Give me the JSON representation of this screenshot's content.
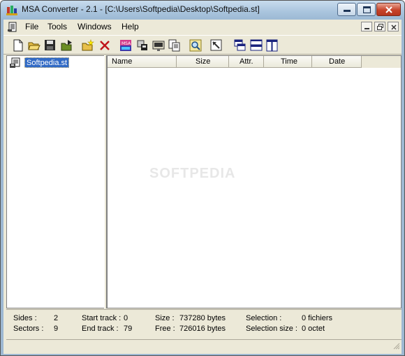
{
  "window": {
    "title": "MSA Converter - 2.1 - [C:\\Users\\Softpedia\\Desktop\\Softpedia.st]"
  },
  "menu": {
    "items": [
      "File",
      "Tools",
      "Windows",
      "Help"
    ]
  },
  "toolbar": {
    "buttons": [
      "new-icon",
      "open-icon",
      "save-icon",
      "export-icon",
      "new-folder-icon",
      "delete-icon",
      "msa-convert-icon",
      "extract-icon",
      "copy-disk-icon",
      "copy-files-icon",
      "search-icon",
      "view-icon",
      "cascade-icon",
      "tile-horizontal-icon",
      "tile-vertical-icon"
    ]
  },
  "tree": {
    "root_label": "Softpedia.st"
  },
  "list": {
    "columns": [
      "Name",
      "Size",
      "Attr.",
      "Time",
      "Date"
    ]
  },
  "watermark": "SOFTPEDIA",
  "status": {
    "sides_label": "Sides :",
    "sides_value": "2",
    "sectors_label": "Sectors :",
    "sectors_value": "9",
    "start_track_label": "Start track :",
    "start_track_value": "0",
    "end_track_label": "End track :",
    "end_track_value": "79",
    "size_label": "Size :",
    "size_value": "737280 bytes",
    "free_label": "Free :",
    "free_value": "726016 bytes",
    "selection_label": "Selection :",
    "selection_value": "0 fichiers",
    "selection_size_label": "Selection size :",
    "selection_size_value": "0 octet"
  },
  "colors": {
    "selection": "#316ac5",
    "close_button": "#c7432a",
    "face": "#ece9d8"
  }
}
